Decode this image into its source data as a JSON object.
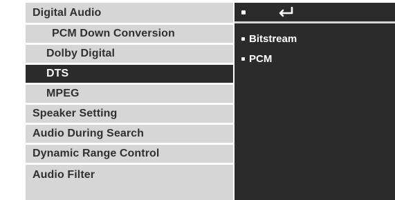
{
  "menu_left": {
    "items": [
      {
        "label": "Digital Audio",
        "level": 0,
        "selected": false
      },
      {
        "label": "PCM Down Conversion",
        "level": 1,
        "selected": false
      },
      {
        "label": "Dolby Digital",
        "level": 1,
        "selected": false
      },
      {
        "label": "DTS",
        "level": 1,
        "selected": true
      },
      {
        "label": "MPEG",
        "level": 1,
        "selected": false
      },
      {
        "label": "Speaker Setting",
        "level": 0,
        "selected": false
      },
      {
        "label": "Audio  During Search",
        "level": 0,
        "selected": false
      },
      {
        "label": "Dynamic Range Control",
        "level": 0,
        "selected": false
      },
      {
        "label": "Audio Filter",
        "level": 0,
        "selected": false
      }
    ]
  },
  "panel_right": {
    "top_icon": "return-icon",
    "options": [
      {
        "label": "Bitstream",
        "highlighted": true
      },
      {
        "label": "PCM",
        "highlighted": false
      }
    ]
  },
  "colors": {
    "menu_bg": "#d6d6d6",
    "menu_text": "#303030",
    "selected_bg": "#2b2b2b",
    "selected_text": "#f5f5f5",
    "panel_bg": "#2b2b2b",
    "panel_text": "#ffffff"
  }
}
